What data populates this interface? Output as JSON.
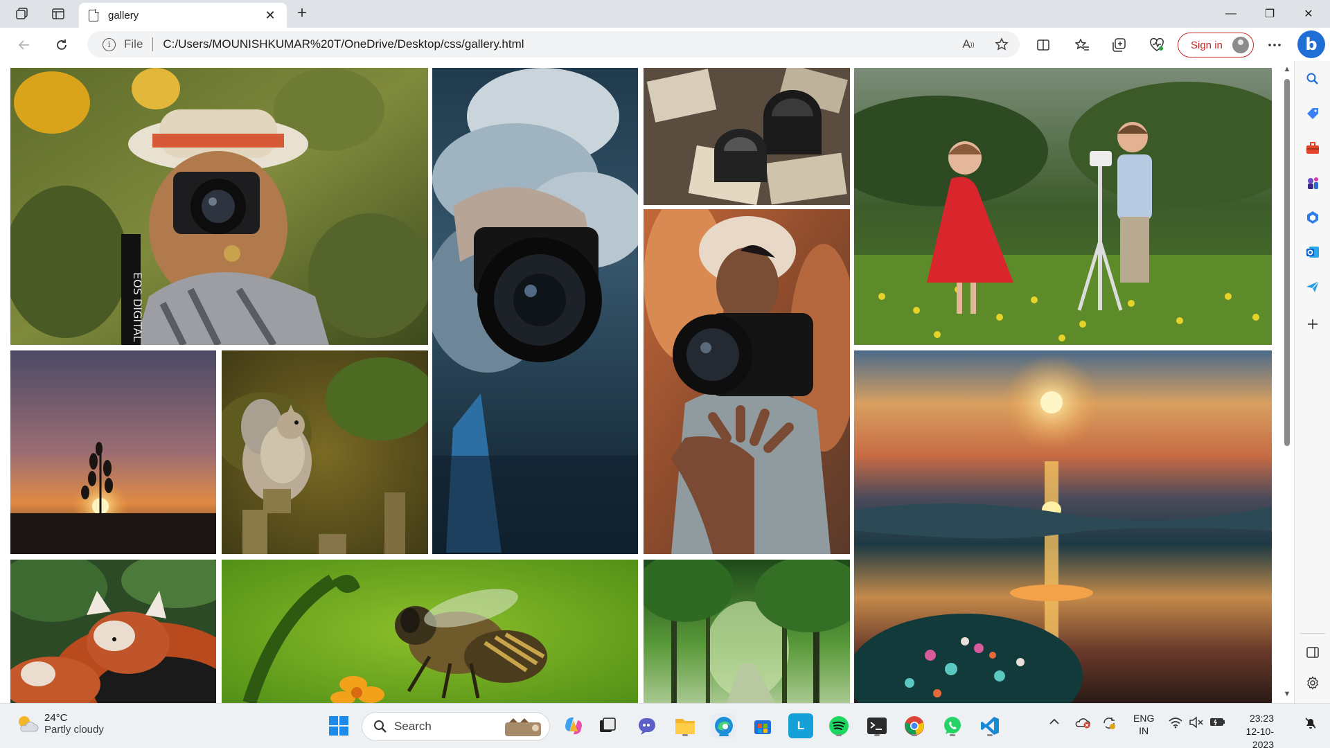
{
  "browser": {
    "tab_title": "gallery",
    "tab_close": "✕",
    "new_tab": "+",
    "address_file_label": "File",
    "url": "C:/Users/MOUNISHKUMAR%20T/OneDrive/Desktop/css/gallery.html",
    "signin_label": "Sign in",
    "window_controls": {
      "minimize": "—",
      "restore": "❐",
      "close": "✕"
    }
  },
  "gallery": {
    "images": [
      {
        "subject": "woman in sun hat taking photo with Canon camera in sunflower field",
        "camera_text": "EOS DIGITAL"
      },
      {
        "subject": "hand holding camera against smoke"
      },
      {
        "subject": "vintage lenses on old photographs"
      },
      {
        "subject": "two children with camera on tripod in meadow"
      },
      {
        "subject": "plant silhouette at sunset"
      },
      {
        "subject": "squirrel on wooden post"
      },
      {
        "subject": "man catching floating Nikon camera"
      },
      {
        "subject": "sunset over the sea"
      },
      {
        "subject": "red panda sleeping"
      },
      {
        "subject": "bee on orange flower"
      },
      {
        "subject": "green forest path"
      }
    ]
  },
  "taskbar": {
    "weather_temp": "24°C",
    "weather_desc": "Partly cloudy",
    "search_placeholder": "Search",
    "language_line1": "ENG",
    "language_line2": "IN",
    "time": "23:23",
    "date": "12-10-2023",
    "apps": [
      "start",
      "search",
      "copilot",
      "task-view",
      "teams",
      "file-explorer",
      "edge",
      "microsoft-store",
      "l-app",
      "spotify",
      "terminal",
      "chrome",
      "whatsapp",
      "vscode"
    ]
  },
  "colors": {
    "titlebar": "#dfe3e8",
    "signin_red": "#c62828",
    "bing_blue": "#1f6fd6",
    "taskbar": "#eef1f4"
  }
}
